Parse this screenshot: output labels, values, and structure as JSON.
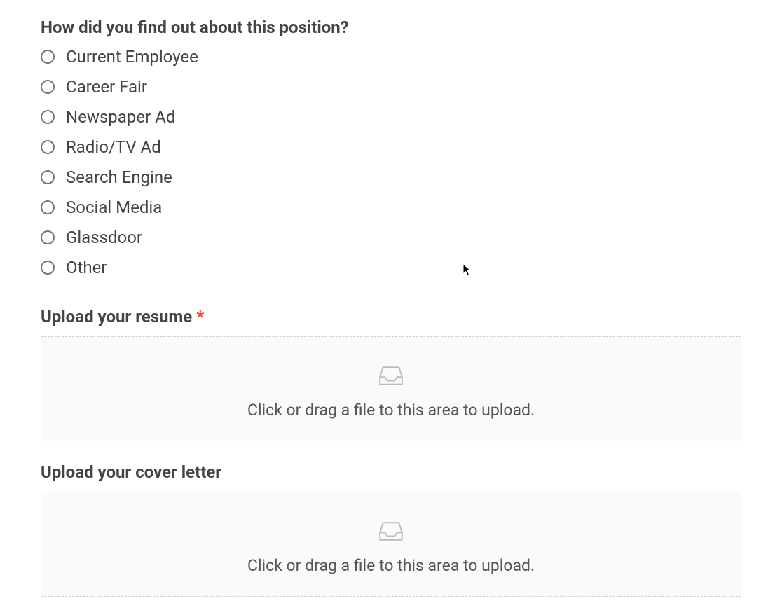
{
  "question": {
    "label": "How did you find out about this position?",
    "options": [
      "Current Employee",
      "Career Fair",
      "Newspaper Ad",
      "Radio/TV Ad",
      "Search Engine",
      "Social Media",
      "Glassdoor",
      "Other"
    ]
  },
  "resume": {
    "label": "Upload your resume ",
    "required_marker": "*",
    "dropzone_text": "Click or drag a file to this area to upload."
  },
  "cover_letter": {
    "label": "Upload your cover letter",
    "dropzone_text": "Click or drag a file to this area to upload."
  }
}
